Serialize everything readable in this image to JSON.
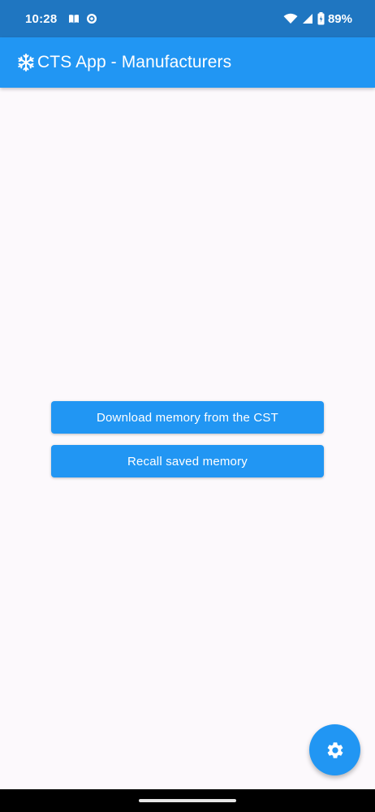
{
  "status_bar": {
    "time": "10:28",
    "battery_text": "89%",
    "icons": [
      "book-icon",
      "target-icon",
      "wifi-icon",
      "signal-icon",
      "battery-icon"
    ]
  },
  "app_bar": {
    "title": "CTS App - Manufacturers",
    "icon": "snowflake-icon"
  },
  "main": {
    "download_button_label": "Download memory from the CST",
    "recall_button_label": "Recall saved memory"
  },
  "fab": {
    "icon": "settings-icon"
  },
  "colors": {
    "status_bar": "#1f76c1",
    "primary": "#2196f3",
    "background": "#fcf9fc"
  }
}
